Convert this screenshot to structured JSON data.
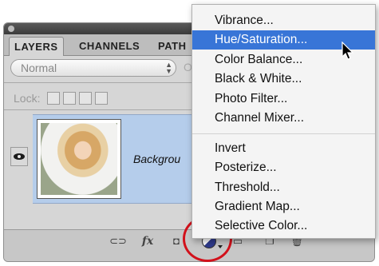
{
  "panel": {
    "tabs": [
      {
        "label": "LAYERS",
        "active": true
      },
      {
        "label": "CHANNELS",
        "active": false
      },
      {
        "label": "PATH",
        "active": false
      }
    ],
    "blend_mode": "Normal",
    "opacity_label_stub": "O",
    "lock_label": "Lock:",
    "layer": {
      "name": "Backgrou",
      "visible": true
    }
  },
  "bottom_icons": [
    "link-icon",
    "fx-icon",
    "mask-icon",
    "adjustment-layer-icon",
    "group-icon",
    "new-layer-icon",
    "trash-icon"
  ],
  "fx_label": "fx",
  "menu": {
    "groups": [
      [
        "Vibrance...",
        "Hue/Saturation...",
        "Color Balance...",
        "Black & White...",
        "Photo Filter...",
        "Channel Mixer..."
      ],
      [
        "Invert",
        "Posterize...",
        "Threshold...",
        "Gradient Map...",
        "Selective Color..."
      ]
    ],
    "highlighted": "Hue/Saturation..."
  },
  "colors": {
    "menu_highlight": "#3875d7",
    "layer_selected": "#b5cdeb",
    "annotation_circle": "#d2111b"
  }
}
